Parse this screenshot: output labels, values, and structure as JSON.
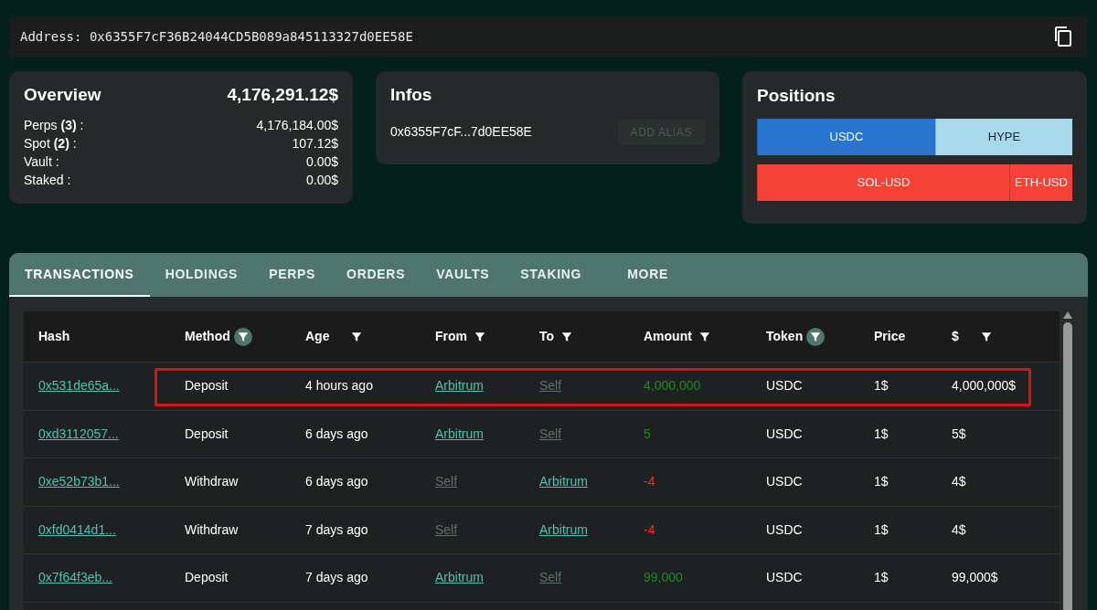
{
  "address": {
    "label": "Address:",
    "value": "0x6355F7cF36B24044CD5B089a845113327d0EE58E"
  },
  "overview": {
    "title": "Overview",
    "total": "4,176,291.12$",
    "rows": [
      {
        "label": "Perps **(3)** :",
        "value": "4,176,184.00$"
      },
      {
        "label": "Spot **(2)** :",
        "value": "107.12$"
      },
      {
        "label": "Vault :",
        "value": "0.00$"
      },
      {
        "label": "Staked :",
        "value": "0.00$"
      }
    ]
  },
  "infos": {
    "title": "Infos",
    "short_address": "0x6355F7cF...7d0EE58E",
    "button": {
      "label": "ADD ALIAS",
      "disabled": true
    }
  },
  "positions": {
    "title": "Positions",
    "groups": [
      [
        {
          "label": "USDC",
          "level": 0.565,
          "color": "#2874cf"
        },
        {
          "label": "HYPE",
          "level": 0.435,
          "color": "#a9d8eb"
        }
      ],
      [
        {
          "label": "SOL-USD",
          "level": 0.8,
          "color": "#f44336"
        },
        {
          "label": "ETH-USD",
          "level": 0.2,
          "color": "#f44336"
        }
      ]
    ]
  },
  "tabs": [
    {
      "label": "TRANSACTIONS",
      "selected": true
    },
    {
      "label": "HOLDINGS",
      "selected": false
    },
    {
      "label": "PERPS",
      "selected": false
    },
    {
      "label": "ORDERS",
      "selected": false
    },
    {
      "label": "VAULTS",
      "selected": false
    },
    {
      "label": "STAKING",
      "selected": false
    },
    {
      "label": "MORE",
      "selected": false
    }
  ],
  "table": {
    "columns": [
      {
        "label": "Hash"
      },
      {
        "label": "Method",
        "filter_active": true
      },
      {
        "label": "Age",
        "filter_active": false
      },
      {
        "label": "From",
        "filter_active": false
      },
      {
        "label": "To",
        "filter_active": false
      },
      {
        "label": "Amount",
        "filter_active": false
      },
      {
        "label": "Token",
        "filter_active": true
      },
      {
        "label": "Price"
      },
      {
        "label": "$",
        "filter_active": false
      }
    ],
    "rows": [
      {
        "highlighted": true,
        "hash": "0x531de65a...",
        "method": "Deposit",
        "age": "4 hours ago",
        "from": {
          "text": "Arbitrum",
          "kind": "external"
        },
        "to": {
          "text": "Self",
          "kind": "self"
        },
        "amount": {
          "text": "4,000,000",
          "kind": "in"
        },
        "token": "USDC",
        "price": "1$",
        "usd": "4,000,000$"
      },
      {
        "highlighted": false,
        "hash": "0xd3112057...",
        "method": "Deposit",
        "age": "6 days ago",
        "from": {
          "text": "Arbitrum",
          "kind": "external"
        },
        "to": {
          "text": "Self",
          "kind": "self"
        },
        "amount": {
          "text": "5",
          "kind": "in"
        },
        "token": "USDC",
        "price": "1$",
        "usd": "5$"
      },
      {
        "highlighted": false,
        "hash": "0xe52b73b1...",
        "method": "Withdraw",
        "age": "6 days ago",
        "from": {
          "text": "Self",
          "kind": "self"
        },
        "to": {
          "text": "Arbitrum",
          "kind": "external"
        },
        "amount": {
          "text": "-4",
          "kind": "out"
        },
        "token": "USDC",
        "price": "1$",
        "usd": "4$"
      },
      {
        "highlighted": false,
        "hash": "0xfd0414d1...",
        "method": "Withdraw",
        "age": "7 days ago",
        "from": {
          "text": "Self",
          "kind": "self"
        },
        "to": {
          "text": "Arbitrum",
          "kind": "external"
        },
        "amount": {
          "text": "-4",
          "kind": "out"
        },
        "token": "USDC",
        "price": "1$",
        "usd": "4$"
      },
      {
        "highlighted": false,
        "hash": "0x7f64f3eb...",
        "method": "Deposit",
        "age": "7 days ago",
        "from": {
          "text": "Arbitrum",
          "kind": "external"
        },
        "to": {
          "text": "Self",
          "kind": "self"
        },
        "amount": {
          "text": "99,000",
          "kind": "in"
        },
        "token": "USDC",
        "price": "1$",
        "usd": "99,000$"
      }
    ]
  }
}
